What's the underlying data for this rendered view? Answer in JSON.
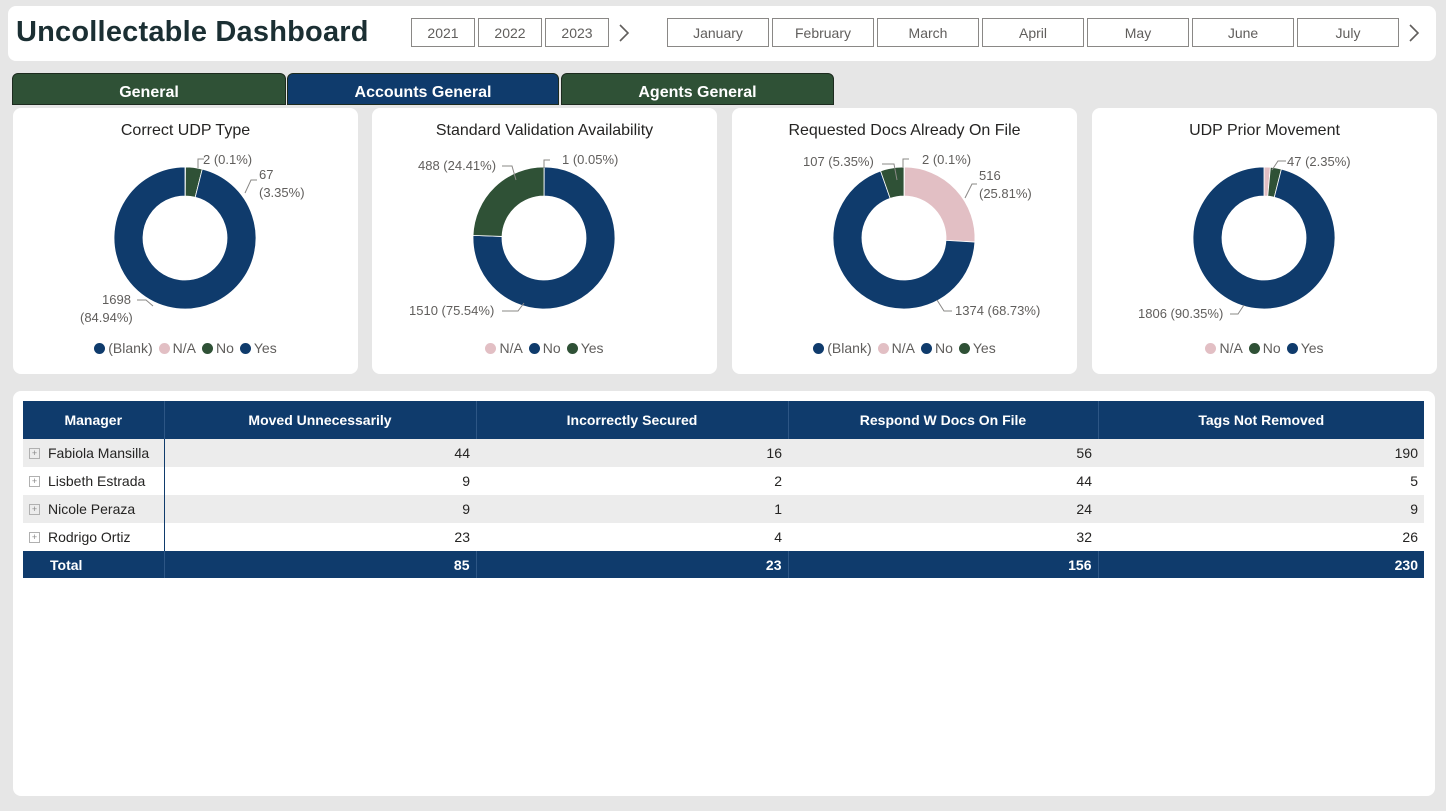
{
  "header": {
    "title": "Uncollectable Dashboard",
    "years": [
      "2021",
      "2022",
      "2023"
    ],
    "months": [
      "January",
      "February",
      "March",
      "April",
      "May",
      "June",
      "July"
    ]
  },
  "tabs": [
    {
      "label": "General"
    },
    {
      "label": "Accounts General"
    },
    {
      "label": "Agents General"
    }
  ],
  "colors": {
    "blank": "#0f3b6c",
    "na": "#e2bfc4",
    "no": "#2f5136",
    "yes": "#0f3b6c",
    "header_bg": "#0f3b6c",
    "tab_green": "#2f5136"
  },
  "chart_data": [
    {
      "type": "pie",
      "title": "Correct UDP Type",
      "categories": [
        "(Blank)",
        "N/A",
        "No",
        "Yes"
      ],
      "values": [
        0,
        2,
        67,
        1698
      ],
      "labels": [
        "",
        "2 (0.1%)",
        "67 (3.35%)",
        "1698 (84.94%)"
      ],
      "legend": [
        "(Blank)",
        "N/A",
        "No",
        "Yes"
      ]
    },
    {
      "type": "pie",
      "title": "Standard Validation Availability",
      "categories": [
        "N/A",
        "No",
        "Yes"
      ],
      "values": [
        1,
        1510,
        488
      ],
      "labels": [
        "1 (0.05%)",
        "1510 (75.54%)",
        "488 (24.41%)"
      ],
      "legend": [
        "N/A",
        "No",
        "Yes"
      ]
    },
    {
      "type": "pie",
      "title": "Requested Docs Already On File",
      "categories": [
        "(Blank)",
        "N/A",
        "No",
        "Yes"
      ],
      "values": [
        2,
        516,
        1374,
        107
      ],
      "labels": [
        "2 (0.1%)",
        "516 (25.81%)",
        "1374 (68.73%)",
        "107 (5.35%)"
      ],
      "legend": [
        "(Blank)",
        "N/A",
        "No",
        "Yes"
      ]
    },
    {
      "type": "pie",
      "title": "UDP Prior Movement",
      "categories": [
        "N/A",
        "No",
        "Yes"
      ],
      "values": [
        27,
        47,
        1806
      ],
      "labels": [
        "",
        "47 (2.35%)",
        "1806 (90.35%)"
      ],
      "legend": [
        "N/A",
        "No",
        "Yes"
      ]
    }
  ],
  "table": {
    "columns": [
      "Manager",
      "Moved Unnecessarily",
      "Incorrectly Secured",
      "Respond W Docs On File",
      "Tags Not Removed"
    ],
    "rows": [
      [
        "Fabiola Mansilla",
        "44",
        "16",
        "56",
        "190"
      ],
      [
        "Lisbeth Estrada",
        "9",
        "2",
        "44",
        "5"
      ],
      [
        "Nicole Peraza",
        "9",
        "1",
        "24",
        "9"
      ],
      [
        "Rodrigo Ortiz",
        "23",
        "4",
        "32",
        "26"
      ]
    ],
    "total": [
      "Total",
      "85",
      "23",
      "156",
      "230"
    ]
  }
}
